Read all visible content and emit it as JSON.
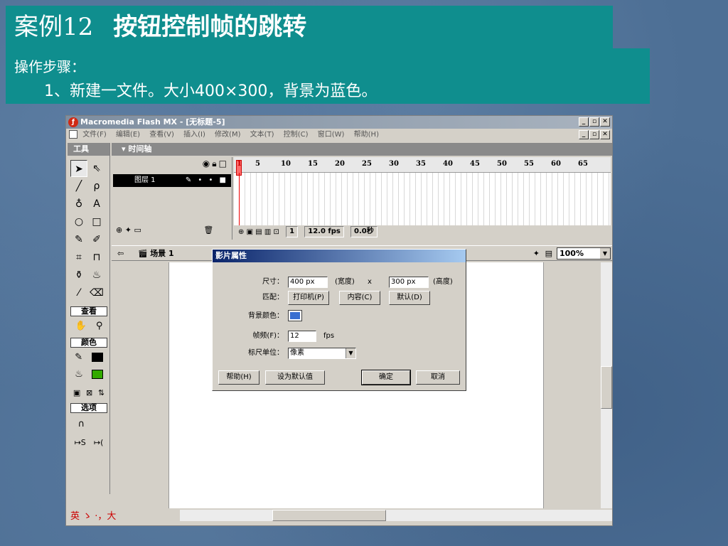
{
  "slide": {
    "title_number": "案例12",
    "title_main": "按钮控制帧的跳转",
    "steps_label": "操作步骤：",
    "step1": "1、新建一文件。大小400×300，背景为蓝色。"
  },
  "window": {
    "title": "Macromedia Flash MX - [无标题-5]",
    "menu": [
      "文件(F)",
      "编辑(E)",
      "查看(V)",
      "插入(I)",
      "修改(M)",
      "文本(T)",
      "控制(C)",
      "窗口(W)",
      "帮助(H)"
    ]
  },
  "toolbox": {
    "title": "工具",
    "view_label": "查看",
    "colors_label": "颜色",
    "options_label": "选项",
    "stroke_color": "#000000",
    "fill_color": "#33aa00"
  },
  "timeline": {
    "title": "时间轴",
    "layer_name": "图层 1",
    "frame_numbers": [
      "1",
      "5",
      "10",
      "15",
      "20",
      "25",
      "30",
      "35",
      "40",
      "45",
      "50",
      "55",
      "60",
      "65"
    ],
    "current_frame": "1",
    "fps": "12.0 fps",
    "elapsed": "0.0秒"
  },
  "scene": {
    "name": "场景 1",
    "zoom": "100%"
  },
  "dialog": {
    "title": "影片属性",
    "size_label": "尺寸：",
    "width_value": "400 px",
    "width_unit": "(宽度)",
    "x_sep": "x",
    "height_value": "300 px",
    "height_unit": "(高度)",
    "match_label": "匹配：",
    "printer_btn": "打印机(P)",
    "contents_btn": "内容(C)",
    "default_btn": "默认(D)",
    "bgcolor_label": "背景颜色：",
    "bg_color": "#3a6fd0",
    "framerate_label": "帧频(F)：",
    "framerate_value": "12",
    "framerate_unit": "fps",
    "ruler_label": "标尺单位：",
    "ruler_value": "像素",
    "help_btn": "帮助(H)",
    "set_default_btn": "设为默认值",
    "ok_btn": "确定",
    "cancel_btn": "取消"
  },
  "ime": {
    "text": "英 ゝ ·，大"
  },
  "colors": {
    "slide_bg": "#4d6f95",
    "title_bar": "#0f8e8e"
  }
}
